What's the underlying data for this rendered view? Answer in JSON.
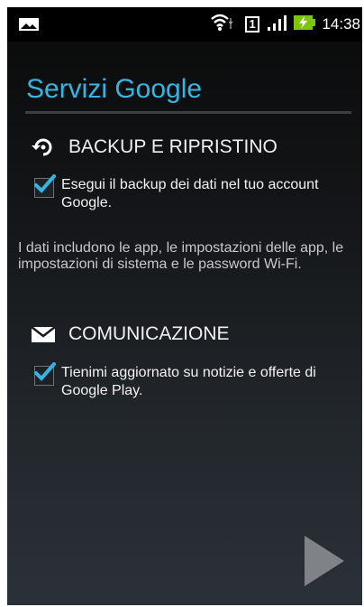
{
  "status_bar": {
    "time": "14:38",
    "icons": [
      "image-notification-icon",
      "wifi-icon",
      "sim-icon",
      "signal-icon",
      "battery-charging-icon"
    ],
    "sim_slot": "1"
  },
  "page": {
    "title": "Servizi Google"
  },
  "backup_section": {
    "icon": "restore-icon",
    "heading": "BACKUP E RIPRISTINO",
    "checkbox_label": "Esegui il backup dei dati nel tuo account Google.",
    "checked": true,
    "description": "I dati includono le app, le impostazioni delle app, le impostazioni di sistema e le password Wi-Fi."
  },
  "communication_section": {
    "icon": "mail-icon",
    "heading": "COMUNICAZIONE",
    "checkbox_label": "Tienimi aggiornato su notizie e offerte di Google Play.",
    "checked": true
  },
  "navigation": {
    "next_icon": "next-arrow-icon"
  },
  "colors": {
    "accent": "#33b5e5",
    "battery": "#7cc40e"
  }
}
